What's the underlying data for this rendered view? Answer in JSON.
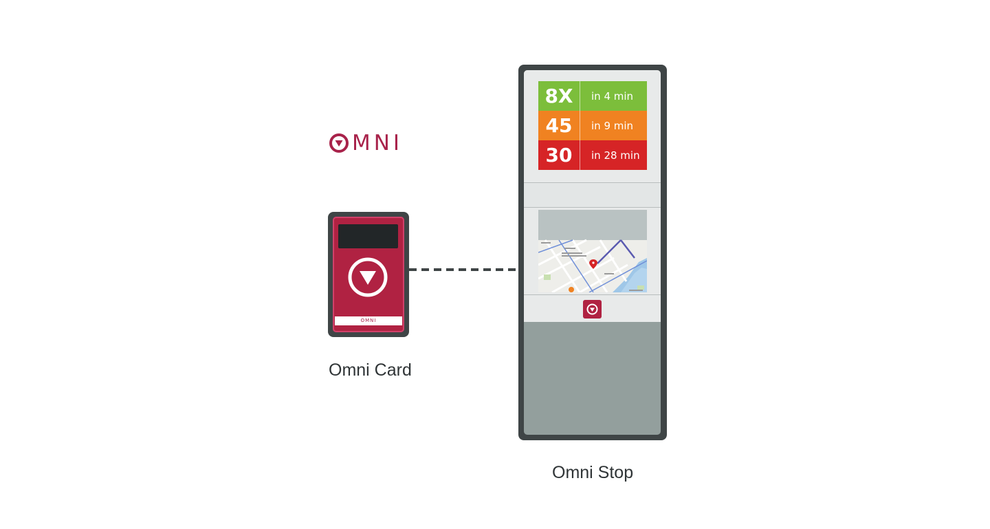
{
  "logo": {
    "text": "MNI",
    "mark_icon": "omni-circle-triangle-icon",
    "color": "#a8224a"
  },
  "card": {
    "caption": "Omni Card",
    "strip_text": "OMNI",
    "emblem_icon": "omni-circle-triangle-icon",
    "colors": {
      "frame": "#3f4546",
      "body": "#b02242",
      "chip": "#222628"
    }
  },
  "connector": {
    "style": "dashed",
    "color": "#3f4546"
  },
  "stop": {
    "caption": "Omni Stop",
    "arrivals": [
      {
        "route": "8X",
        "time": "in 4 min",
        "color": "#7cbe3b"
      },
      {
        "route": "45",
        "time": "in 9 min",
        "color": "#f08221"
      },
      {
        "route": "30",
        "time": "in 28 min",
        "color": "#d62426"
      }
    ],
    "badge_icon": "omni-circle-triangle-icon",
    "map_icon": "map-pin-icon",
    "colors": {
      "frame": "#3f4546",
      "body": "#939f9d",
      "panel": "#e8eaea"
    }
  }
}
